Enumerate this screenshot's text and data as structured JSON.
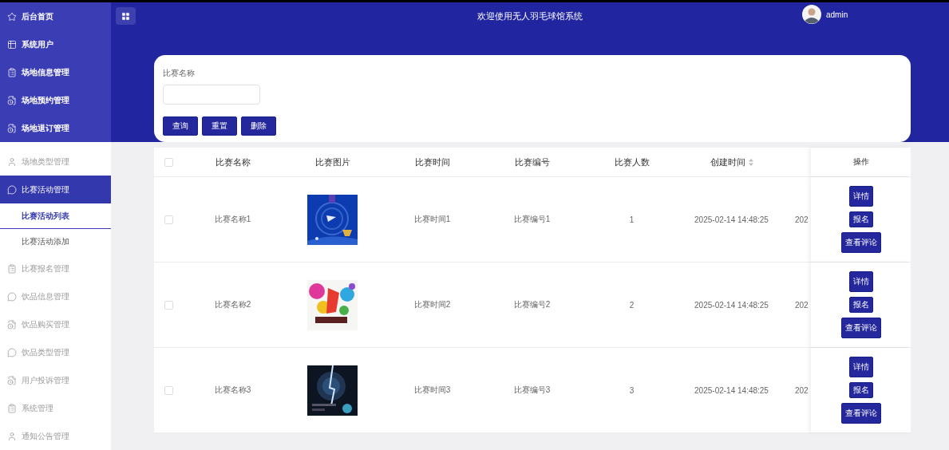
{
  "header": {
    "title": "欢迎使用无人羽毛球馆系统",
    "user": "admin"
  },
  "sidebar": {
    "top_items": [
      {
        "label": "后台首页",
        "selected": false
      },
      {
        "label": "系统用户",
        "selected": false
      },
      {
        "label": "场地信息管理",
        "selected": false
      },
      {
        "label": "场地预约管理",
        "selected": false
      },
      {
        "label": "场地退订管理",
        "selected": false
      }
    ],
    "items": [
      {
        "label": "场地类型管理",
        "selected": false
      },
      {
        "label": "比赛活动管理",
        "selected": true,
        "children": [
          {
            "label": "比赛活动列表",
            "selected": true
          },
          {
            "label": "比赛活动添加",
            "selected": false
          }
        ]
      },
      {
        "label": "比赛报名管理",
        "selected": false
      },
      {
        "label": "饮品信息管理",
        "selected": false
      },
      {
        "label": "饮品购买管理",
        "selected": false
      },
      {
        "label": "饮品类型管理",
        "selected": false
      },
      {
        "label": "用户投诉管理",
        "selected": false
      },
      {
        "label": "系统管理",
        "selected": false
      },
      {
        "label": "通知公告管理",
        "selected": false
      }
    ]
  },
  "search": {
    "label": "比赛名称",
    "buttons": [
      "查询",
      "重置",
      "删除"
    ]
  },
  "table": {
    "select_all": {
      "checked": false
    },
    "columns": [
      {
        "label": "比赛名称",
        "sortable": false
      },
      {
        "label": "比赛图片",
        "sortable": false
      },
      {
        "label": "比赛时间",
        "sortable": false
      },
      {
        "label": "比赛编号",
        "sortable": false
      },
      {
        "label": "比赛人数",
        "sortable": false
      },
      {
        "label": "创建时间",
        "sortable": true
      }
    ],
    "actions_header": "操作",
    "rows": [
      {
        "checked": false,
        "name": "比赛名称1",
        "time": "比赛时间1",
        "number": "比赛编号1",
        "count": "1",
        "created": "2025-02-14 14:48:25",
        "column_8": "202",
        "actions": [
          "详情",
          "报名",
          "查看评论"
        ]
      },
      {
        "checked": false,
        "name": "比赛名称2",
        "time": "比赛时间2",
        "number": "比赛编号2",
        "count": "2",
        "created": "2025-02-14 14:48:25",
        "column_8": "202",
        "actions": [
          "详情",
          "报名",
          "查看评论"
        ]
      },
      {
        "checked": false,
        "name": "比赛名称3",
        "time": "比赛时间3",
        "number": "比赛编号3",
        "count": "3",
        "created": "2025-02-14 14:48:25",
        "column_8": "202",
        "actions": [
          "详情",
          "报名",
          "查看评论"
        ]
      }
    ]
  }
}
